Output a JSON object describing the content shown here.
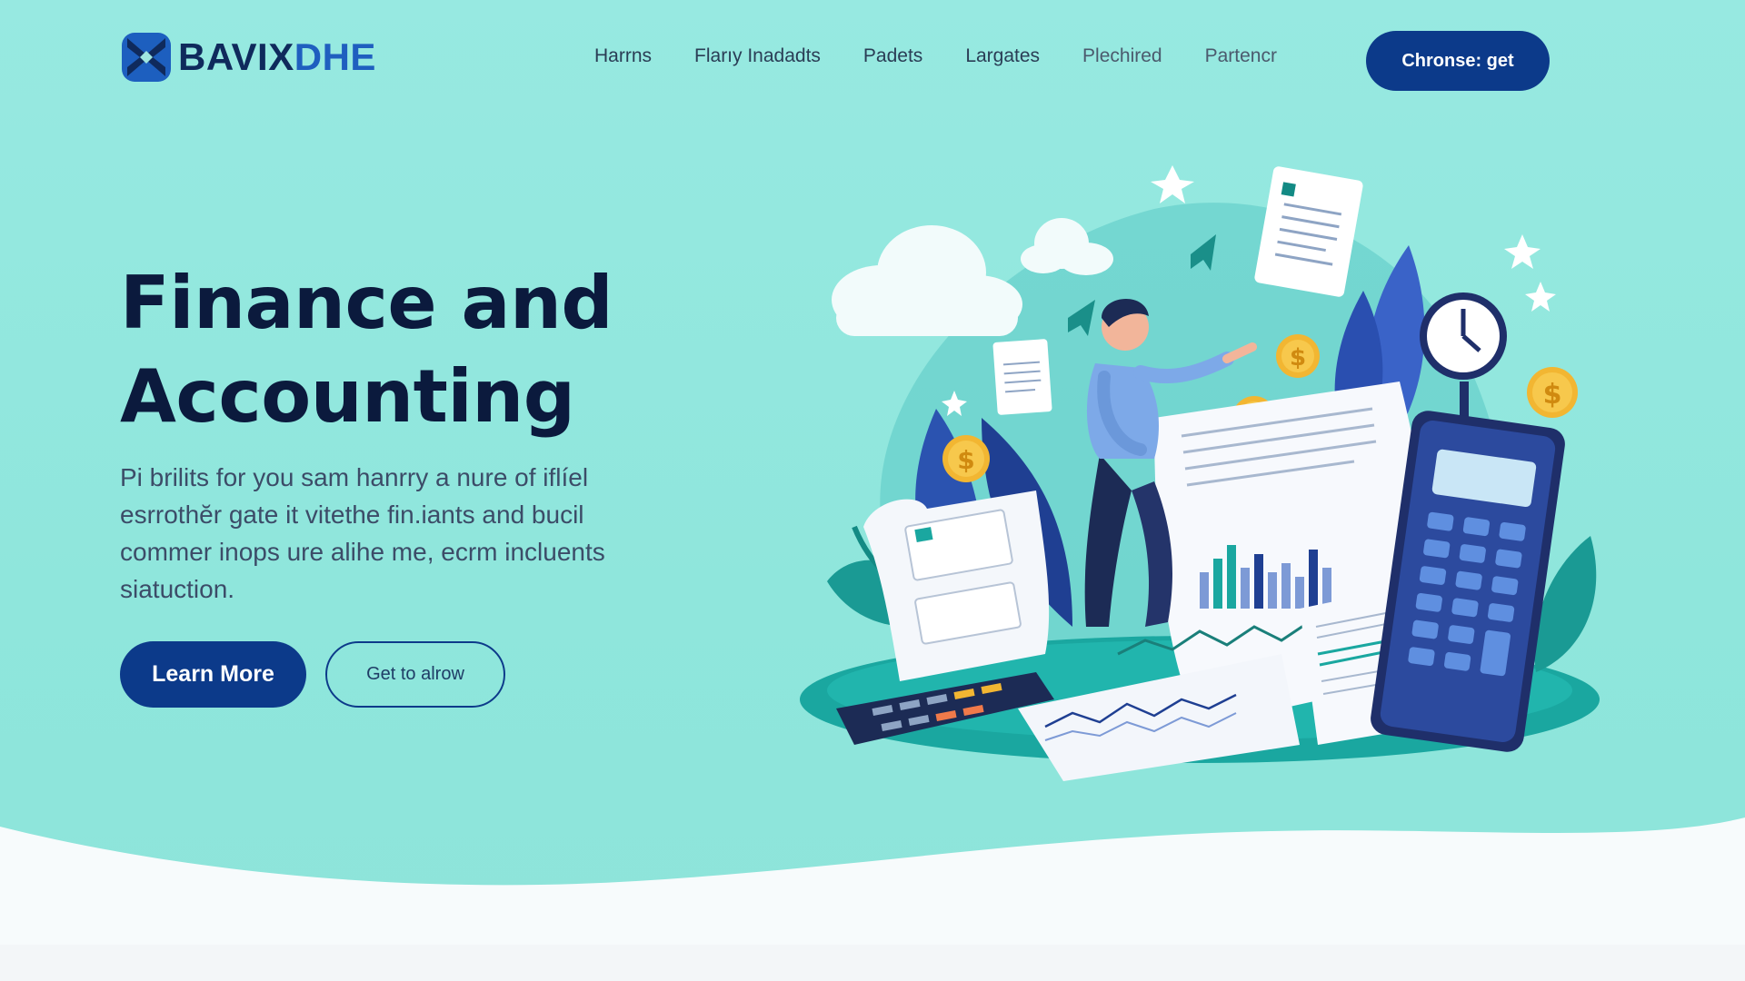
{
  "brand": {
    "name_part1": "BAVIX",
    "name_part2": "DHE"
  },
  "nav": {
    "items": [
      "Harrns",
      "Flarıy Inadadts",
      "Padets",
      "Largates",
      "Plechired",
      "Partencr"
    ]
  },
  "header_cta": "Chronse: get",
  "hero": {
    "title_line1": "Finance and",
    "title_line2": "Accounting",
    "copy": "Pi brilits for you sam hanrry a nure of iflíel esrrothĕr gate it vitethe fin.iants and bucil commer inops ure alihe me, ecrm incluents siatuction.",
    "primary_button": "Learn More",
    "secondary_button": "Get to alrow"
  },
  "colors": {
    "background": "#94e8df",
    "primary": "#0c3a8a",
    "heading": "#0b1a3d",
    "accent_teal": "#1aa7a0"
  }
}
